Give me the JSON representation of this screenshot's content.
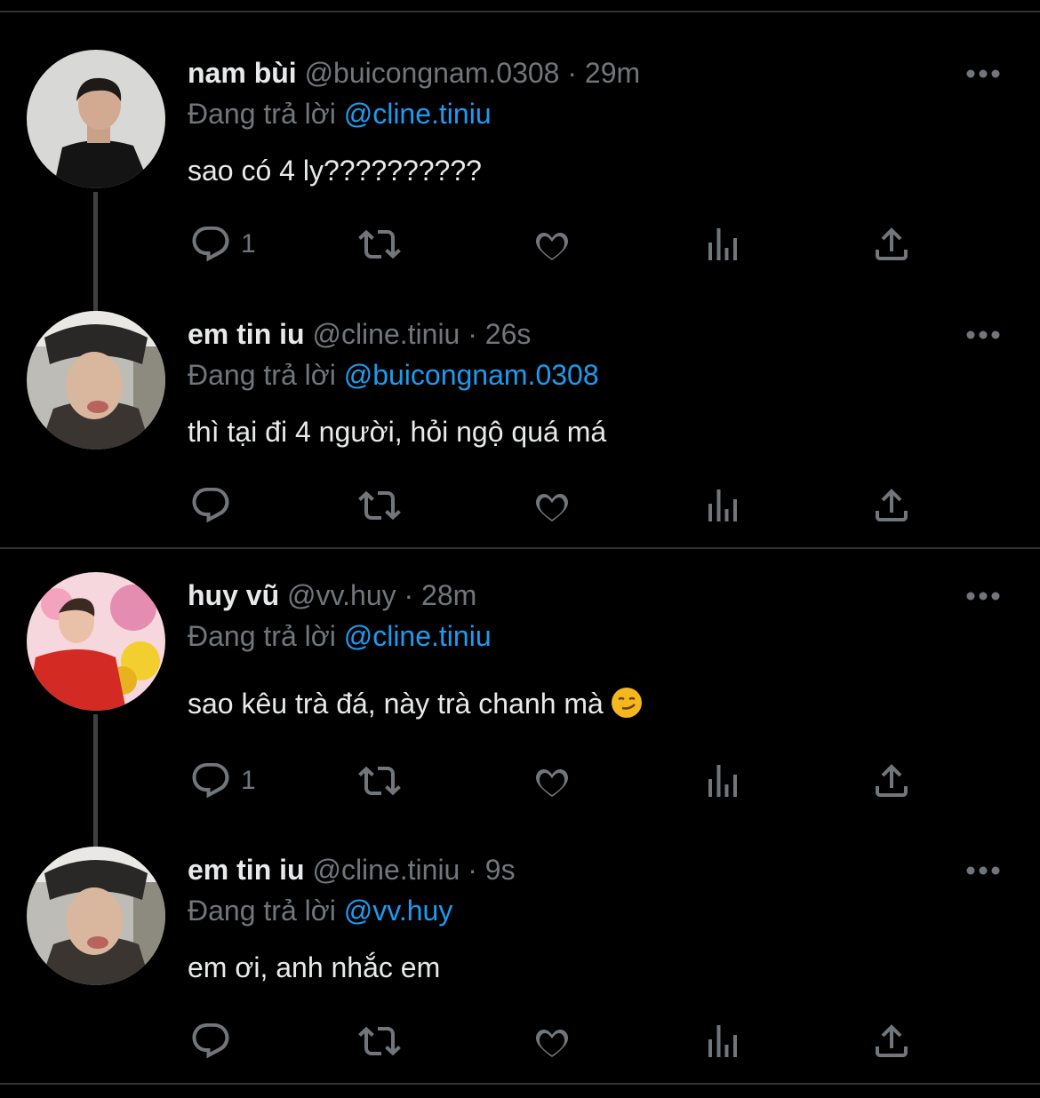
{
  "replies_label": "Đang trả lời",
  "colors": {
    "background": "#000000",
    "accent": "#1d9bf0",
    "muted": "#71767b",
    "text": "#e7e9ea",
    "divider": "#2f3336"
  },
  "tweets": [
    {
      "name": "nam bùi",
      "handle": "@buicongnam.0308",
      "time": "29m",
      "reply_to": "@cline.tiniu",
      "text": "sao có 4 ly??????????",
      "reply_count": "1",
      "avatar": "avatar-nam"
    },
    {
      "name": "em tin iu",
      "handle": "@cline.tiniu",
      "time": "26s",
      "reply_to": "@buicongnam.0308",
      "text": "thì tại đi 4 người, hỏi ngộ quá má",
      "reply_count": "",
      "avatar": "avatar-em"
    },
    {
      "name": "huy vũ",
      "handle": "@vv.huy",
      "time": "28m",
      "reply_to": "@cline.tiniu",
      "text": "sao kêu trà đá, này trà chanh mà",
      "emoji": "smirking-face",
      "reply_count": "1",
      "avatar": "avatar-huy"
    },
    {
      "name": "em tin iu",
      "handle": "@cline.tiniu",
      "time": "9s",
      "reply_to": "@vv.huy",
      "text": "em ơi, anh nhắc em",
      "reply_count": "",
      "avatar": "avatar-em"
    }
  ],
  "icons": [
    "reply-icon",
    "retweet-icon",
    "like-icon",
    "views-icon",
    "share-icon",
    "more-icon"
  ]
}
